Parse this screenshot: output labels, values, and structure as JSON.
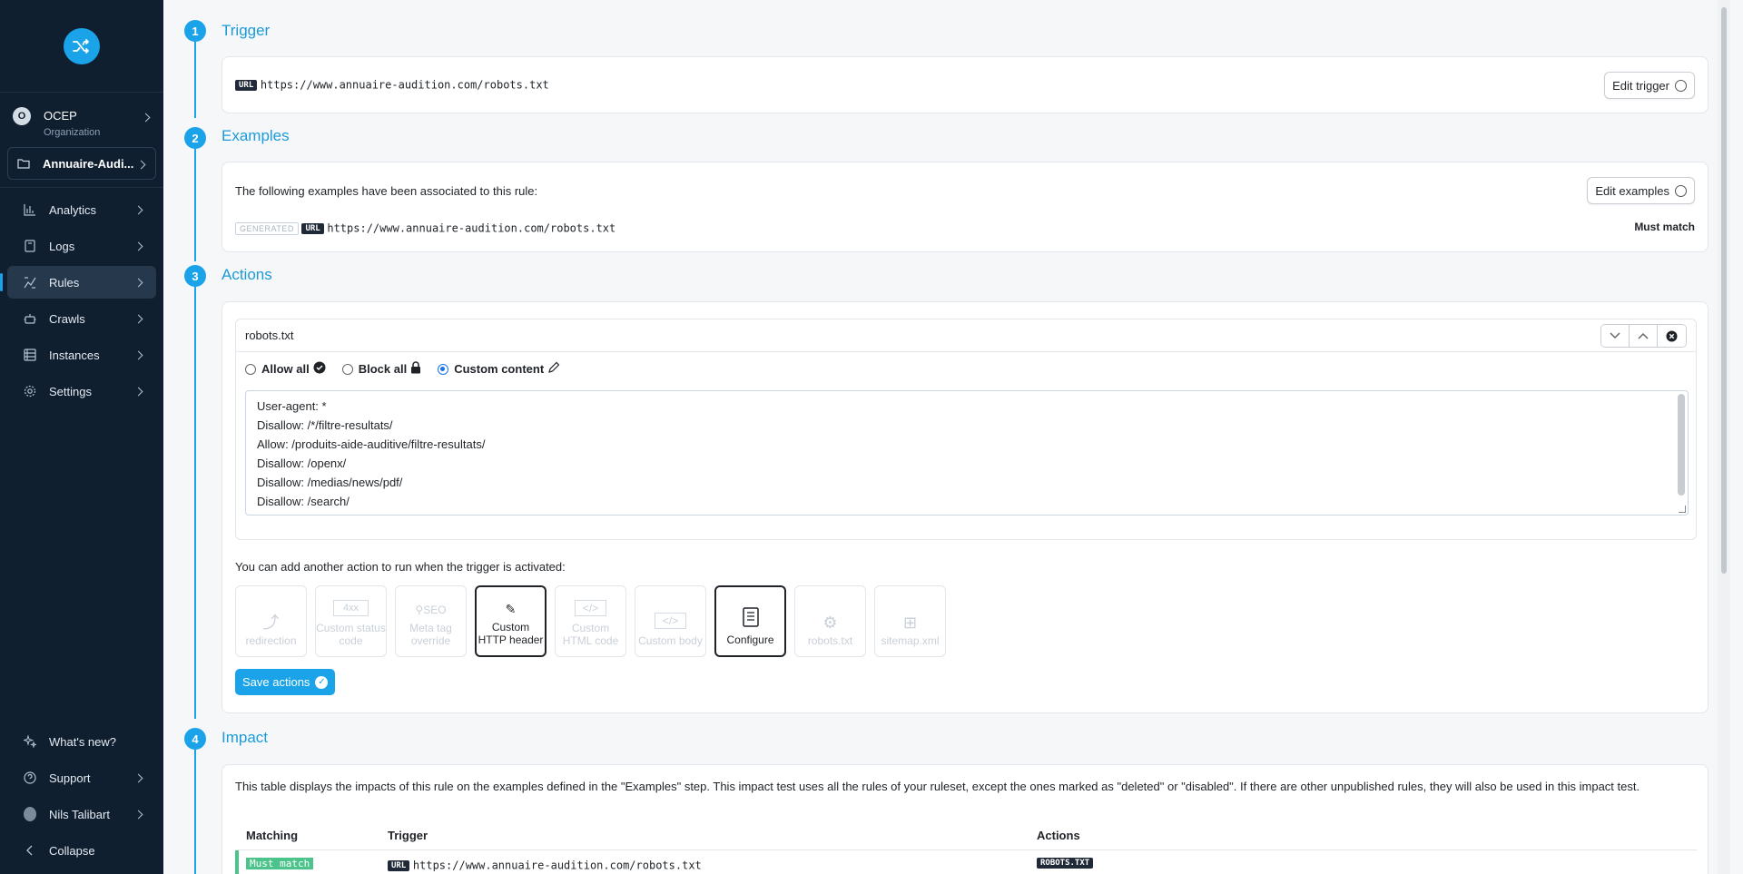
{
  "sidebar": {
    "org": {
      "initial": "O",
      "name": "OCEP",
      "sub": "Organization"
    },
    "project": "Annuaire-Audi...",
    "items": [
      {
        "label": "Analytics",
        "icon": "bar-chart-icon"
      },
      {
        "label": "Logs",
        "icon": "document-icon"
      },
      {
        "label": "Rules",
        "icon": "rules-icon",
        "active": true
      },
      {
        "label": "Crawls",
        "icon": "robot-icon"
      },
      {
        "label": "Instances",
        "icon": "server-icon"
      },
      {
        "label": "Settings",
        "icon": "gear-icon"
      }
    ],
    "bottom": {
      "whats_new": "What's new?",
      "support": "Support",
      "user": "Nils Talibart",
      "collapse": "Collapse"
    }
  },
  "steps": {
    "trigger": {
      "num": "1",
      "title": "Trigger",
      "url_tag": "URL",
      "url": "https://www.annuaire-audition.com/robots.txt",
      "edit_label": "Edit trigger"
    },
    "examples": {
      "num": "2",
      "title": "Examples",
      "intro": "The following examples have been associated to this rule:",
      "edit_label": "Edit examples",
      "generated_tag": "GENERATED",
      "url_tag": "URL",
      "url": "https://www.annuaire-audition.com/robots.txt",
      "match": "Must match"
    },
    "actions": {
      "num": "3",
      "title": "Actions",
      "box_title": "robots.txt",
      "radio_allow": "Allow all",
      "radio_block": "Block all",
      "radio_custom": "Custom content",
      "content_lines": [
        "User-agent: *",
        "Disallow: /*/filtre-resultats/",
        "Allow: /produits-aide-auditive/filtre-resultats/",
        "Disallow: /openx/",
        "Disallow: /medias/news/pdf/",
        "Disallow: /search/"
      ],
      "hint": "You can add another action to run when the trigger is activated:",
      "tiles": [
        {
          "label": "redirection",
          "icon": "redirection-icon",
          "enabled": false
        },
        {
          "label": "Custom status code",
          "icon": "status-code-icon",
          "enabled": false
        },
        {
          "label": "Meta tag override",
          "icon": "seo-icon",
          "enabled": false
        },
        {
          "label": "Custom HTTP header",
          "icon": "edit-icon",
          "enabled": true
        },
        {
          "label": "Custom HTML code",
          "icon": "code-icon",
          "enabled": false
        },
        {
          "label": "Custom body",
          "icon": "code-file-icon",
          "enabled": false
        },
        {
          "label": "Configure",
          "icon": "configure-icon",
          "enabled": true
        },
        {
          "label": "robots.txt",
          "icon": "robot-icon",
          "enabled": false
        },
        {
          "label": "sitemap.xml",
          "icon": "sitemap-icon",
          "enabled": false
        }
      ],
      "save_label": "Save actions"
    },
    "impact": {
      "num": "4",
      "title": "Impact",
      "text": "This table displays the impacts of this rule on the examples defined in the \"Examples\" step. This impact test uses all the rules of your ruleset, except the ones marked as \"deleted\" or \"disabled\". If there are other unpublished rules, they will also be used in this impact test.",
      "columns": [
        "Matching",
        "Trigger",
        "Actions"
      ],
      "row": {
        "matching": "Must match",
        "url_tag": "URL",
        "trigger": "https://www.annuaire-audition.com/robots.txt",
        "action": "ROBOTS.TXT"
      }
    }
  },
  "colors": {
    "accent": "#1aa3e8",
    "sidebar": "#0f1f30",
    "match": "#4cc38a"
  }
}
